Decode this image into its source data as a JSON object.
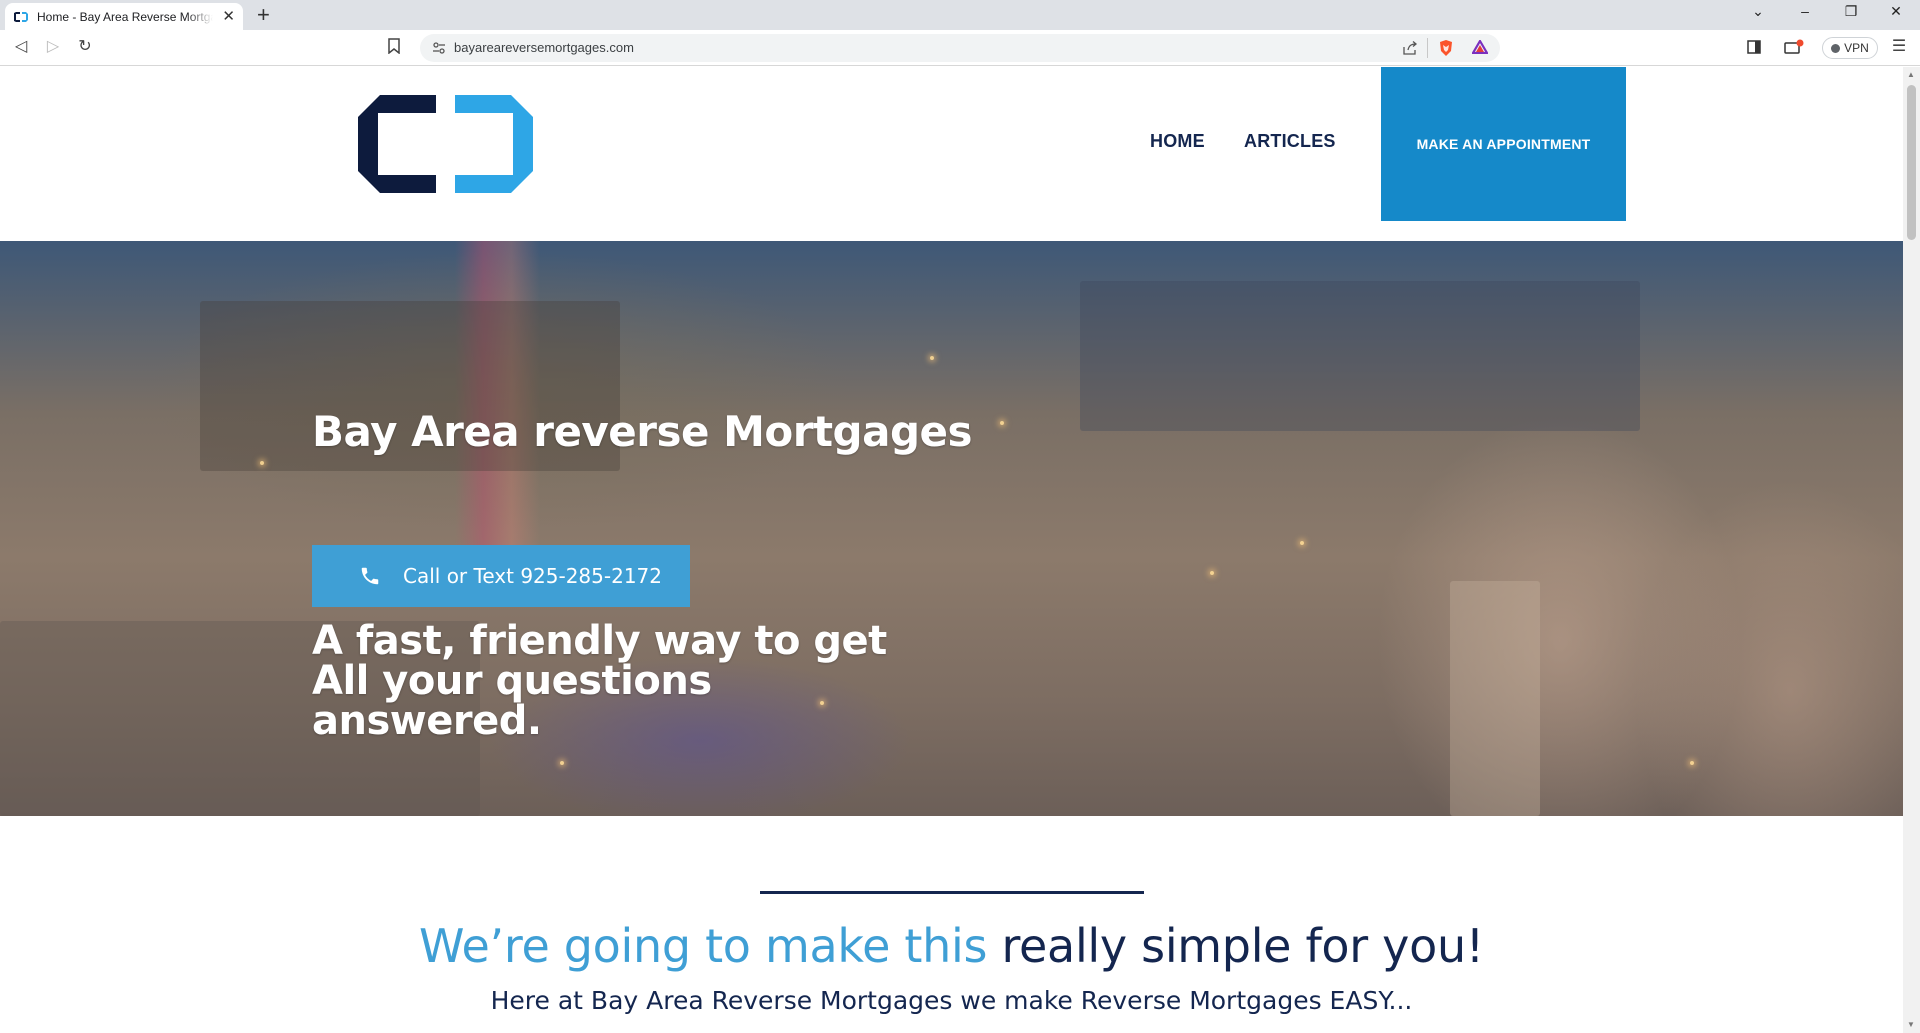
{
  "browser": {
    "tab_title": "Home - Bay Area Reverse Mortgages",
    "url": "bayareareversemortgages.com",
    "vpn_label": "VPN"
  },
  "header": {
    "nav": [
      {
        "label": "HOME"
      },
      {
        "label": "ARTICLES"
      }
    ],
    "cta_label": "MAKE AN APPOINTMENT"
  },
  "hero": {
    "title": "Bay Area reverse Mortgages",
    "call_label": "Call or Text 925-285-2172",
    "subtitle": "A fast, friendly way to get All your questions answered."
  },
  "intro": {
    "heading_accent": "We’re going to make this",
    "heading_dark": "really simple for you!",
    "subheading": "Here at Bay Area Reverse Mortgages we make Reverse Mortgages EASY..."
  },
  "colors": {
    "navy": "#14264f",
    "brand_blue": "#1589c9",
    "light_blue": "#3f9fd5"
  }
}
